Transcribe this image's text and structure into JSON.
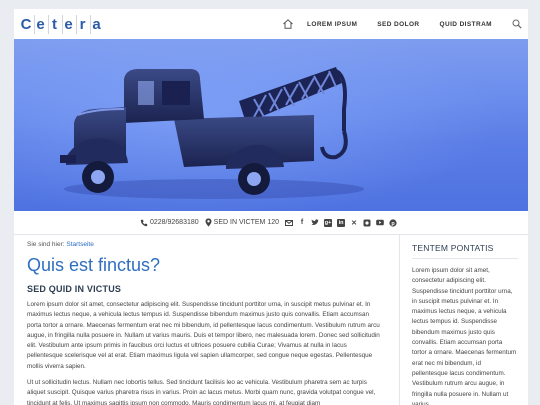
{
  "logo": {
    "letters": [
      "C",
      "e",
      "t",
      "e",
      "r",
      "a"
    ]
  },
  "nav": {
    "items": [
      "LOREM IPSUM",
      "SED DOLOR",
      "QUID DISTRAM"
    ]
  },
  "contact": {
    "phone": "0228/92683180",
    "address": "SED IN VICTEM 120",
    "social": [
      "mail-icon",
      "facebook-icon",
      "twitter-icon",
      "google-plus-icon",
      "linkedin-icon",
      "xing-icon",
      "instagram-icon",
      "youtube-icon",
      "pinterest-icon"
    ]
  },
  "breadcrumb": {
    "prefix": "Sie sind hier:",
    "link": "Startseite"
  },
  "main": {
    "title": "Quis est finctus?",
    "subtitle": "SED QUID IN VICTUS",
    "para1": "Lorem ipsum dolor sit amet, consectetur adipiscing elit. Suspendisse tincidunt porttitor urna, in suscipit metus pulvinar et. In maximus lectus neque, a vehicula lectus tempus id. Suspendisse bibendum maximus justo quis convallis. Etiam accumsan porta tortor a ornare. Maecenas fermentum erat nec mi bibendum, id pellentesque lacus condimentum. Vestibulum rutrum arcu augue, in fringilla nulla posuere in. Nullam ut varius mauris. Duis et tempor libero, nec malesuada lorem. Donec sed sollicitudin elit. Vestibulum ante ipsum primis in faucibus orci luctus et ultrices posuere cubilia Curae; Vivamus at nulla in lacus pellentesque scelerisque vel at erat. Etiam maximus ligula vel sapien ullamcorper, sed congue neque egestas. Pellentesque mollis viverra sapien.",
    "para2": "Ut ut sollicitudin lectus. Nullam nec lobortis tellus. Sed tincidunt facilisis leo ac vehicula. Vestibulum pharetra sem ac turpis aliquet suscipit. Quisque varius pharetra risus in varius. Proin ac lacus metus. Morbi quam nunc, gravida volutpat congue vel, tincidunt at felis. Ut maximus sagittis ipsum non commodo. Mauris condimentum lacus mi, at feugiat diam"
  },
  "sidebar": {
    "title": "TENTEM PONTATIS",
    "text": "Lorem ipsum dolor sit amet, consectetur adipiscing elit. Suspendisse tincidunt porttitor urna, in suscipit metus pulvinar et. In maximus lectus neque, a vehicula lectus tempus id. Suspendisse bibendum maximus justo quis convallis. Etiam accumsan porta tortor a ornare. Maecenas fermentum erat nec mi bibendum, id pellentesque lacus condimentum. Vestibulum rutrum arcu augue, in fringilla nulla posuere in. Nullam ut varius"
  },
  "colors": {
    "accent": "#2e6fbf",
    "hero": "#5a7de6",
    "background": "#e9ecf1"
  }
}
